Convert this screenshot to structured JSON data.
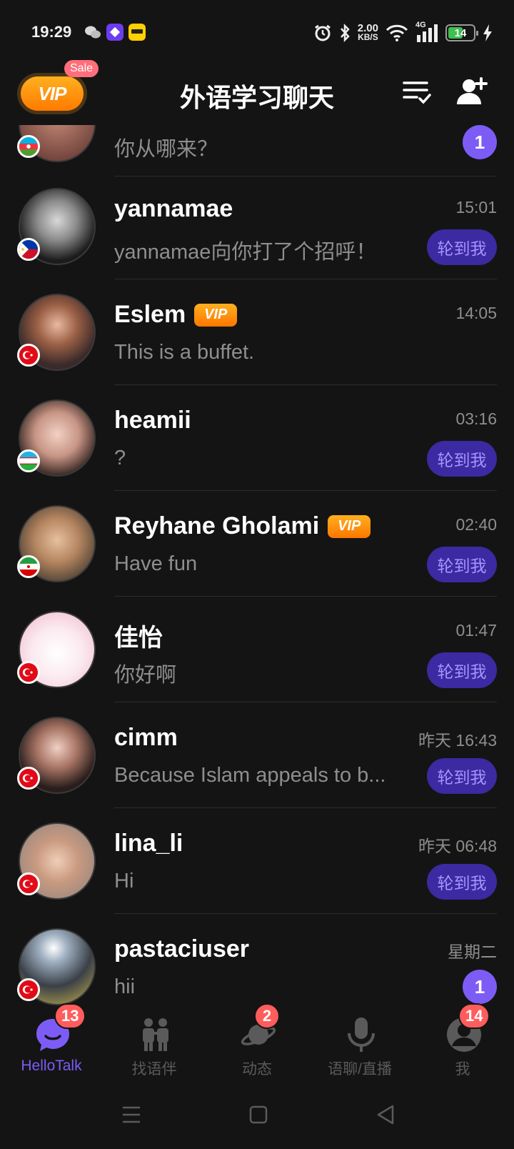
{
  "status_bar": {
    "time": "19:29",
    "net_speed": "2.00",
    "net_unit": "KB/S",
    "signal": "4G",
    "battery": "14"
  },
  "header": {
    "vip_label": "VIP",
    "sale_label": "Sale",
    "title": "外语学习聊天"
  },
  "chats": [
    {
      "name": "",
      "preview": "你从哪来？",
      "time": "",
      "unread": "1",
      "flag": "az"
    },
    {
      "name": "yannamae",
      "preview": "yannamae向你打了个招呼！",
      "time": "15:01",
      "action": "轮到我",
      "flag": "ph"
    },
    {
      "name": "Eslem",
      "vip": "VIP",
      "preview": "This is a buffet.",
      "time": "14:05",
      "flag": "tr"
    },
    {
      "name": "heamii",
      "preview": "?",
      "time": "03:16",
      "action": "轮到我",
      "flag": "uz"
    },
    {
      "name": "Reyhane Gholami",
      "vip": "VIP",
      "preview": "Have fun",
      "time": "02:40",
      "action": "轮到我",
      "flag": "ir"
    },
    {
      "name": "佳怡",
      "preview": "你好啊",
      "time": "01:47",
      "action": "轮到我",
      "flag": "tr"
    },
    {
      "name": "cimm",
      "preview": "Because Islam appeals to b...",
      "time": "昨天 16:43",
      "action": "轮到我",
      "flag": "tr"
    },
    {
      "name": "lina_li",
      "preview": "Hi",
      "time": "昨天 06:48",
      "action": "轮到我",
      "flag": "tr"
    },
    {
      "name": "pastaciuser",
      "preview": "hii",
      "time": "星期二",
      "unread": "1",
      "flag": "tr"
    }
  ],
  "tabs": [
    {
      "label": "HelloTalk",
      "badge": "13",
      "active": true
    },
    {
      "label": "找语伴"
    },
    {
      "label": "动态",
      "badge": "2"
    },
    {
      "label": "语聊/直播"
    },
    {
      "label": "我",
      "badge": "14"
    }
  ],
  "colors": {
    "background": "#141414",
    "accent": "#7d5cf6",
    "turn_button_bg": "#3b2aa1",
    "vip_orange": "#ff8a00",
    "badge_red": "#ff5c5c"
  }
}
